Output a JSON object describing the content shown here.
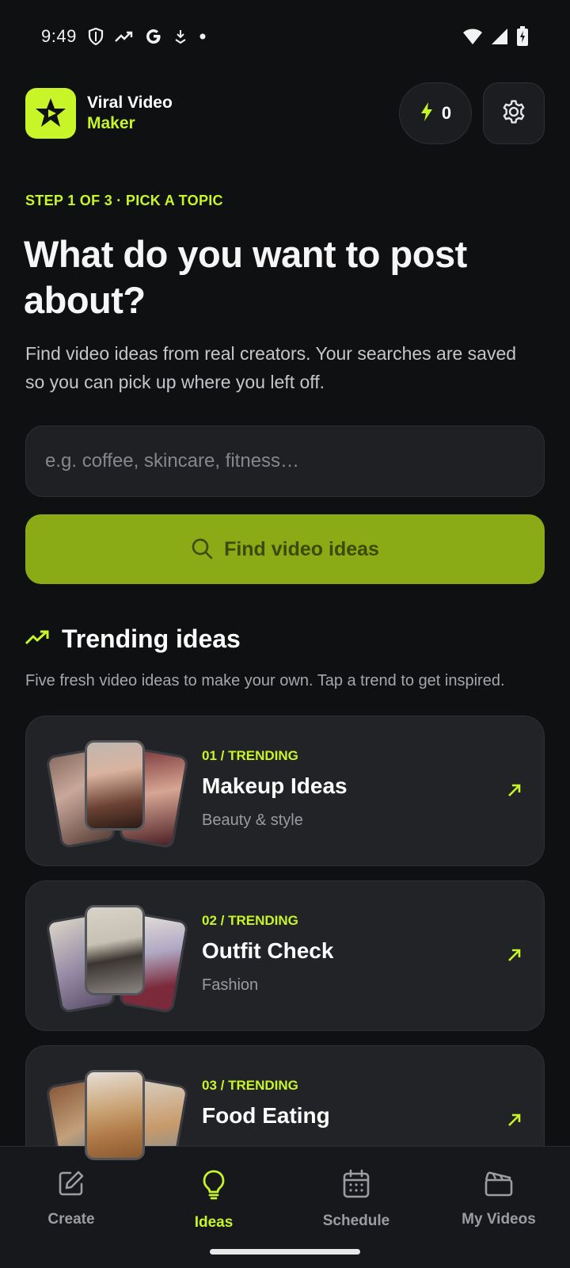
{
  "status_bar": {
    "time": "9:49",
    "icons_left": [
      "shield-icon",
      "trending-icon",
      "google-icon",
      "download-icon",
      "dot-icon"
    ],
    "icons_right": [
      "wifi-icon",
      "signal-icon",
      "battery-charging-icon"
    ]
  },
  "app": {
    "name_line1": "Viral Video",
    "name_line2": "Maker",
    "credits": "0",
    "accent": "#c7f528"
  },
  "step_label": "STEP 1 OF 3 · PICK A TOPIC",
  "headline": "What do you want to post about?",
  "subtitle": "Find video ideas from real creators. Your searches are saved so you can pick up where you left off.",
  "search": {
    "placeholder": "e.g. coffee, skincare, fitness…",
    "value": ""
  },
  "find_button": "Find video ideas",
  "trending": {
    "title": "Trending ideas",
    "subtitle": "Five fresh video ideas to make your own. Tap a trend to get inspired.",
    "items": [
      {
        "tag": "01 / TRENDING",
        "title": "Makeup Ideas",
        "category": "Beauty & style"
      },
      {
        "tag": "02 / TRENDING",
        "title": "Outfit Check",
        "category": "Fashion"
      },
      {
        "tag": "03 / TRENDING",
        "title": "Food Eating",
        "category": ""
      }
    ]
  },
  "bottom_nav": [
    {
      "label": "Create",
      "icon": "edit-icon",
      "active": false
    },
    {
      "label": "Ideas",
      "icon": "lightbulb-icon",
      "active": true
    },
    {
      "label": "Schedule",
      "icon": "calendar-icon",
      "active": false
    },
    {
      "label": "My Videos",
      "icon": "clapperboard-icon",
      "active": false
    }
  ]
}
